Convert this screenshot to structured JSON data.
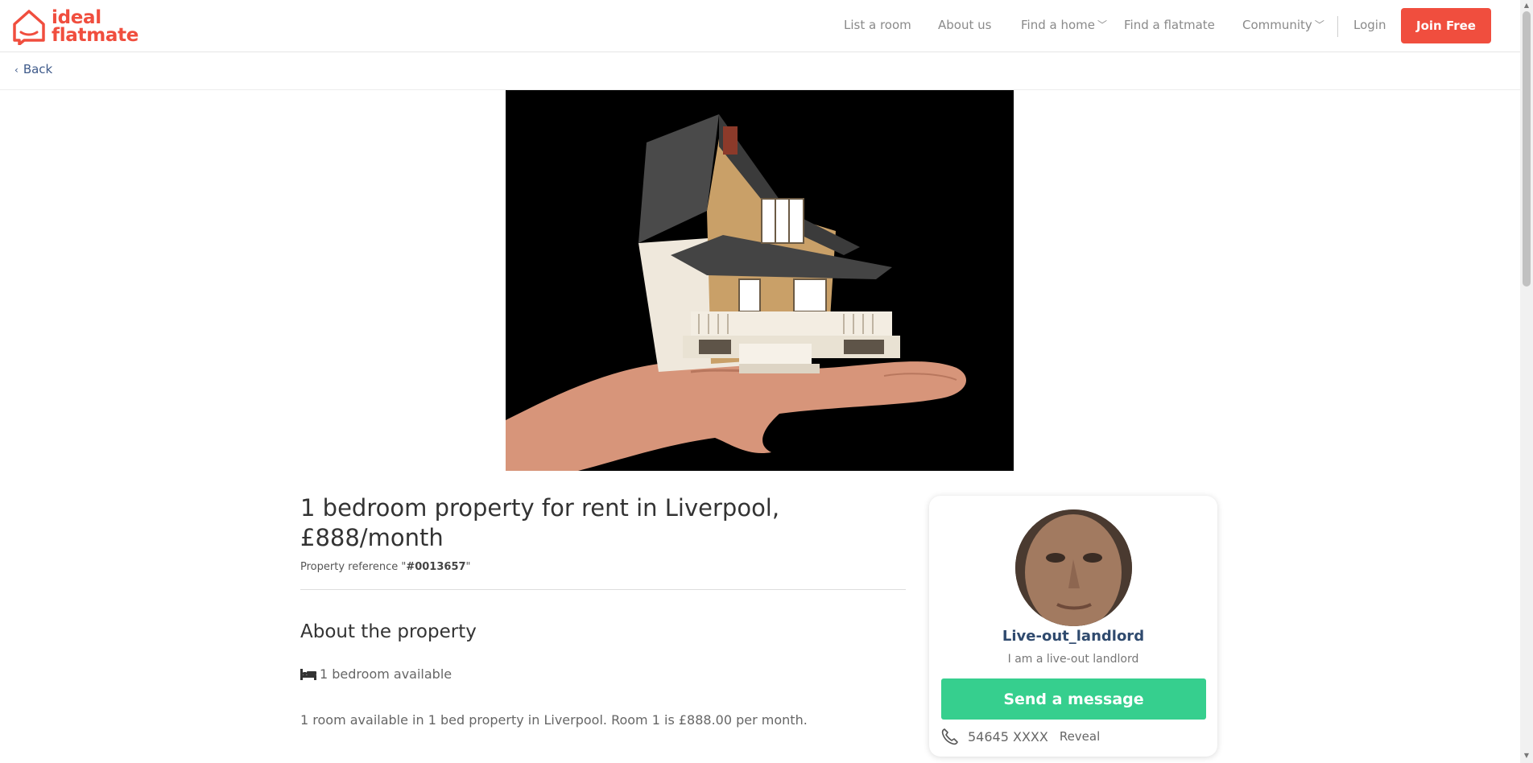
{
  "brand": {
    "line1": "ideal",
    "line2": "flatmate",
    "color": "#f04e3e"
  },
  "nav": {
    "list_room": "List a room",
    "about": "About us",
    "find_home": "Find a home",
    "find_flatmate": "Find a flatmate",
    "community": "Community",
    "login": "Login",
    "join": "Join Free"
  },
  "back": "Back",
  "listing": {
    "title": "1 bedroom property for rent in Liverpool, £888/month",
    "ref_label": "Property reference \"",
    "ref_value": "#0013657",
    "ref_end": "\"",
    "about_heading": "About the property",
    "bedrooms": "1 bedroom available",
    "description": "1 room available in 1 bed property in Liverpool. Room 1 is £888.00 per month."
  },
  "profile": {
    "username": "Live-out_landlord",
    "tagline": "I am a live-out landlord",
    "message_button": "Send a message",
    "phone": "54645 XXXX",
    "reveal": "Reveal"
  },
  "colors": {
    "accent": "#f04e3e",
    "cta_green": "#36cf8e",
    "link_blue": "#3e5a8a"
  }
}
